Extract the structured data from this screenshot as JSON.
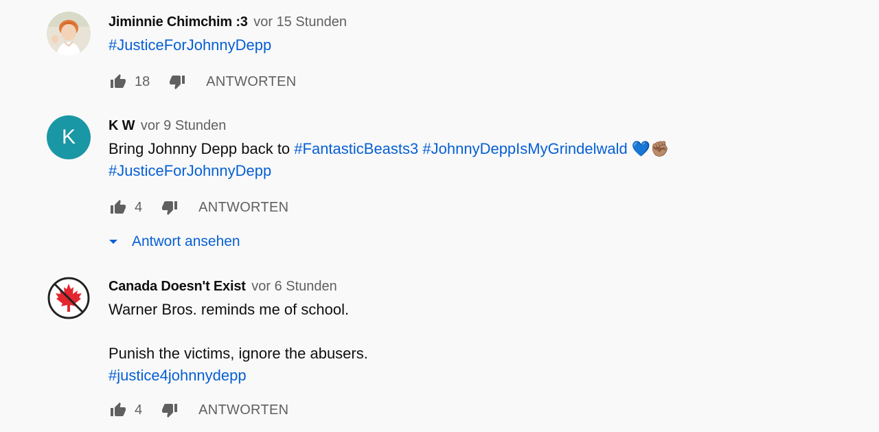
{
  "comments": [
    {
      "author": "Jiminnie Chimchim :3",
      "time": "vor 15 Stunden",
      "avatar": {
        "type": "photo",
        "colors": {
          "bg": "#e8e3d6",
          "hair": "#e07a3a",
          "skin": "#f2d3b8",
          "shirt": "#ffffff"
        }
      },
      "text_before": "",
      "hashtags": [
        "#JusticeForJohnnyDepp"
      ],
      "likes": "18",
      "reply_label": "ANTWORTEN"
    },
    {
      "author": "K W",
      "time": "vor 9 Stunden",
      "avatar": {
        "type": "letter",
        "letter": "K",
        "color": "#1a97a5"
      },
      "text_before": "Bring Johnny Depp back to ",
      "hashtags": [
        "#FantasticBeasts3",
        "#JohnnyDeppIsMyGrindelwald",
        "#JusticeForJohnnyDepp"
      ],
      "emojis": [
        "💙",
        "✊🏽"
      ],
      "likes": "4",
      "reply_label": "ANTWORTEN",
      "view_replies_label": "Antwort ansehen"
    },
    {
      "author": "Canada Doesn't Exist",
      "time": "vor 6 Stunden",
      "avatar": {
        "type": "no-canada",
        "colors": {
          "circle": "#222222",
          "leaf": "#e3262f",
          "bg": "#ffffff"
        }
      },
      "lines": [
        "Warner Bros. reminds me of school.",
        "",
        "Punish the victims, ignore the abusers."
      ],
      "hashtags": [
        "#justice4johnnydepp"
      ],
      "likes": "4",
      "reply_label": "ANTWORTEN"
    }
  ],
  "colors": {
    "background": "#f9f9f9",
    "link": "#065fd4",
    "secondary_text": "#606060",
    "icon": "#606060"
  },
  "icons": {
    "like": "thumb-up-icon",
    "dislike": "thumb-down-icon",
    "expand": "caret-down-icon"
  }
}
